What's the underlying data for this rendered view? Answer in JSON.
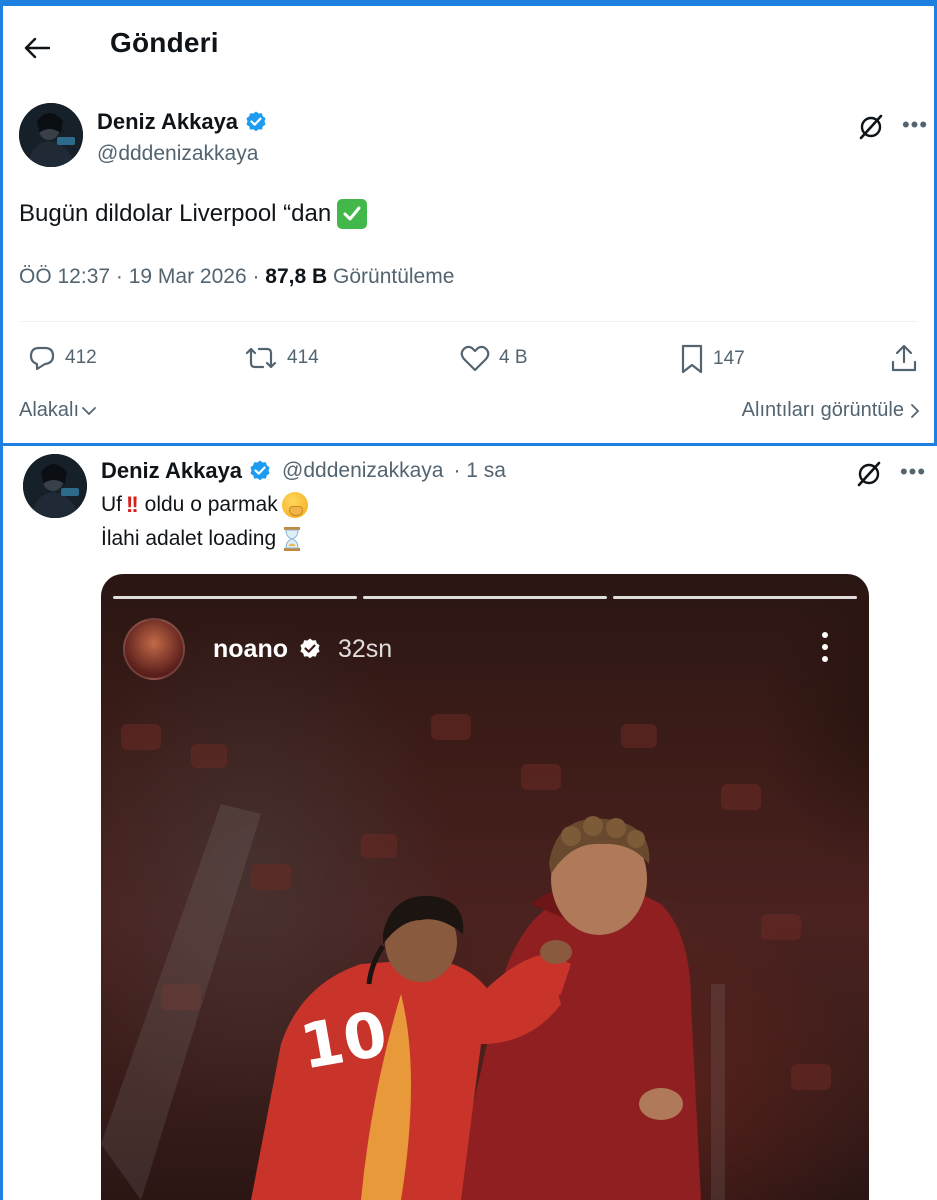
{
  "header": {
    "title": "Gönderi"
  },
  "main_post": {
    "author_name": "Deniz Akkaya",
    "handle": "@dddenizakkaya",
    "text": "Bugün dildolar Liverpool “dan",
    "time": "ÖÖ 12:37 · 19 Mar 2026 · ",
    "views_count": "87,8 B",
    "views_label": "Görüntüleme",
    "replies": "412",
    "reposts": "414",
    "likes": "4 B",
    "bookmarks": "147",
    "related_label": "Alakalı",
    "quotes_label": "Alıntıları görüntüle"
  },
  "reply_post": {
    "author_name": "Deniz Akkaya",
    "handle": "@dddenizakkaya",
    "age": "· 1 sa",
    "line1_a": "Uf",
    "line1_b": " oldu o parmak",
    "line2": "İlahi adalet loading"
  },
  "story": {
    "username": "noano",
    "time": "32sn"
  },
  "colors": {
    "accent": "#1d9bf0",
    "frame_border": "#1d7fe0",
    "secondary_text": "#536471"
  },
  "icons": [
    "back-arrow-icon",
    "verified-badge-icon",
    "grok-icon",
    "more-icon",
    "reply-icon",
    "repost-icon",
    "like-icon",
    "bookmark-icon",
    "share-icon",
    "chevron-down-icon",
    "chevron-right-icon",
    "check-mark-emoji",
    "double-exclamation-emoji",
    "hand-over-mouth-emoji",
    "hourglass-emoji"
  ]
}
